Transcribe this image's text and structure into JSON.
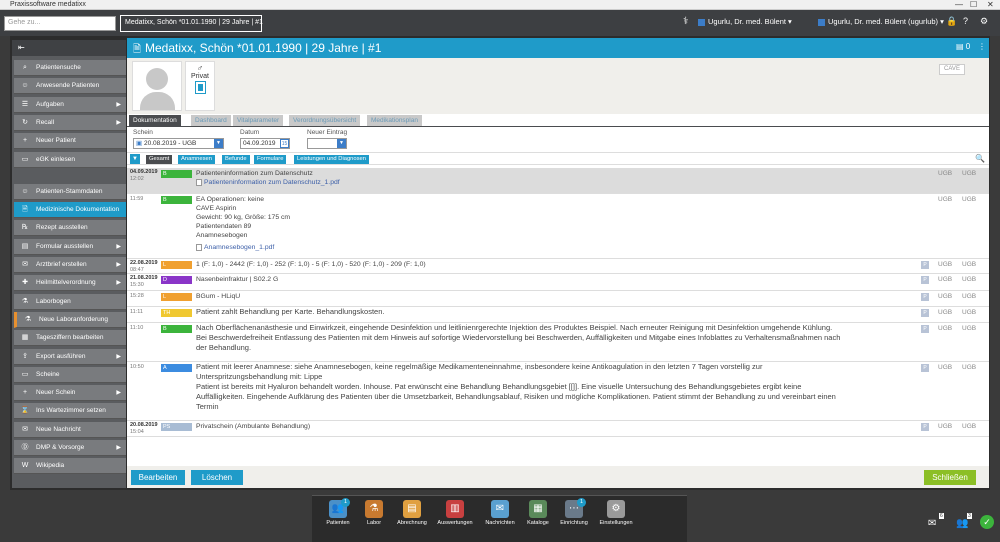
{
  "window_title": "Praxissoftware medatixx",
  "topbar": {
    "search_placeholder": "Gehe zu...",
    "patient_context": "Medatixx, Schön *01.01.1990 | 29 Jahre | #1",
    "user1": "Ugurlu, Dr. med. Bülent",
    "user2": "Ugurlu, Dr. med. Bülent (ugurlub)"
  },
  "header": {
    "title": "Medatixx, Schön *01.01.1990 | 29 Jahre | #1",
    "count": "0"
  },
  "patient": {
    "gender_symbol": "♂",
    "insurance": "Privat",
    "cave": "CAVE"
  },
  "sidebar": {
    "items": [
      {
        "label": "Patientensuche",
        "icon": "person-search-icon"
      },
      {
        "label": "Anwesende Patienten",
        "icon": "people-icon"
      },
      {
        "label": "Aufgaben",
        "icon": "tasks-icon"
      },
      {
        "label": "Recall",
        "icon": "recall-icon"
      },
      {
        "label": "Neuer Patient",
        "icon": "new-patient-icon"
      },
      {
        "label": "eGK einlesen",
        "icon": "card-icon"
      },
      {
        "label": "Patienten-Stammdaten",
        "icon": "person-icon"
      },
      {
        "label": "Medizinische Dokumentation",
        "icon": "doc-icon"
      },
      {
        "label": "Rezept ausstellen",
        "icon": "prescription-icon"
      },
      {
        "label": "Formular ausstellen",
        "icon": "form-icon"
      },
      {
        "label": "Arztbrief erstellen",
        "icon": "letter-icon"
      },
      {
        "label": "Heilmittelverordnung",
        "icon": "remedy-icon"
      },
      {
        "label": "Laborbogen",
        "icon": "lab-icon"
      },
      {
        "label": "Neue Laboranforderung",
        "icon": "lab-request-icon"
      },
      {
        "label": "Tagesziffern bearbeiten",
        "icon": "day-codes-icon"
      },
      {
        "label": "Export ausführen",
        "icon": "export-icon"
      },
      {
        "label": "Scheine",
        "icon": "voucher-icon"
      },
      {
        "label": "Neuer Schein",
        "icon": "new-voucher-icon"
      },
      {
        "label": "Ins Wartezimmer setzen",
        "icon": "waiting-room-icon"
      },
      {
        "label": "Neue Nachricht",
        "icon": "message-icon"
      },
      {
        "label": "DMP & Vorsorge",
        "icon": "dmp-icon"
      },
      {
        "label": "Wikipedia",
        "icon": "wikipedia-icon"
      }
    ]
  },
  "tabs": [
    "Dokumentation",
    "Dashboard",
    "Vitalparameter",
    "Verordnungsübersicht",
    "Medikationsplan"
  ],
  "filters": {
    "schein_label": "Schein",
    "schein_value": "20.08.2019 - UGB",
    "datum_label": "Datum",
    "datum_value": "04.09.2019",
    "neuer_eintrag_label": "Neuer Eintrag",
    "buttons": [
      "Gesamt",
      "Anamnesen",
      "Befunde",
      "Formulare",
      "Leistungen und Diagnosen"
    ]
  },
  "entries": [
    {
      "date": "04.09.2019",
      "time": "12:02",
      "tag": "B",
      "color": "#3cb43c",
      "lines": [
        "Patienteninformation zum Datenschutz"
      ],
      "pdf": "Patienteninformation zum Datenschutz_1.pdf",
      "ugb1": "UGB",
      "ugb2": "UGB"
    },
    {
      "date": "",
      "time": "11:59",
      "tag": "B",
      "color": "#3cb43c",
      "lines": [
        "EA Operationen: keine",
        "CAVE Aspirin",
        "Gewicht: 90 kg, Größe: 175 cm",
        "Patientendaten 89",
        "Anamnesebogen"
      ],
      "pdf": "Anamnesebogen_1.pdf",
      "ugb1": "UGB",
      "ugb2": "UGB"
    },
    {
      "date": "22.08.2019",
      "time": "08:47",
      "tag": "L",
      "color": "#f0a030",
      "lines": [
        "1 (F: 1,0) - 2442 (F: 1,0) - 252 (F: 1,0) - 5 (F: 1,0) - 520 (F: 1,0) - 209 (F: 1,0)"
      ],
      "ugb1": "UGB",
      "ugb2": "UGB",
      "p": "P"
    },
    {
      "date": "21.08.2019",
      "time": "15:30",
      "tag": "D",
      "color": "#8a35c8",
      "lines": [
        "Nasenbeinfraktur | S02.2 G"
      ],
      "ugb1": "UGB",
      "ugb2": "UGB",
      "p": "P"
    },
    {
      "date": "",
      "time": "15:28",
      "tag": "L",
      "color": "#f0a030",
      "lines": [
        "BGum - HLiqU"
      ],
      "ugb1": "UGB",
      "ugb2": "UGB",
      "p": "P"
    },
    {
      "date": "",
      "time": "11:11",
      "tag": "TH",
      "color": "#f0c830",
      "lines": [
        "Patient zahlt Behandlung per Karte. Behandlungskosten."
      ],
      "ugb1": "UGB",
      "ugb2": "UGB",
      "p": "P"
    },
    {
      "date": "",
      "time": "11:10",
      "tag": "B",
      "color": "#3cb43c",
      "lines": [
        "Nach Oberflächenanästhesie und Einwirkzeit, eingehende Desinfektion und leitlinienrgerechte Injektion des Produktes Beispiel. Nach erneuter Reinigung mit Desinfektion umgehende Kühlung.",
        "Bei Beschwerdefreiheit Entlassung des Patienten mit dem Hinweis auf sofortige Wiedervorstellung bei Beschwerden, Auffälligkeiten und Mitgabe eines Infoblattes zu Verhaltensmaßnahmen nach",
        "der Behandlung."
      ],
      "ugb1": "UGB",
      "ugb2": "UGB",
      "p": "P"
    },
    {
      "date": "",
      "time": "10:50",
      "tag": "A",
      "color": "#3c8ce0",
      "lines": [
        "Patient mit leerer Anamnese: siehe Anamnesebogen, keine regelmäßige Medikamenteneinnahme, insbesondere keine Antikoagulation in den letzten 7 Tagen vorstellig zur",
        "Unterspritzungsbehandlung mit: Lippe",
        "Patient ist bereits mit Hyaluron behandelt worden. Inhouse. Pat erwünscht eine Behandlung Behandlungsgebiet [[]]. Eine visuelle Untersuchung des Behandlungsgebietes ergibt keine",
        "Auffälligkeiten. Eingehende Aufklärung des Patienten über die Umsetzbarkeit, Behandlungsablauf, Risiken und mögliche Komplikationen. Patient stimmt der Behandlung zu und vereinbart einen",
        "Termin"
      ],
      "ugb1": "UGB",
      "ugb2": "UGB",
      "p": "P"
    },
    {
      "date": "20.08.2019",
      "time": "15:04",
      "tag": "PS",
      "color": "#a8bcd4",
      "lines": [
        "Privatschein (Ambulante Behandlung)"
      ],
      "ugb1": "UGB",
      "ugb2": "UGB",
      "p": "P"
    }
  ],
  "bottom": {
    "edit": "Bearbeiten",
    "delete": "Löschen",
    "close": "Schließen"
  },
  "taskbar": [
    {
      "label": "Patienten",
      "icon": "patients-icon",
      "badge": "1",
      "color": "#4a90c8"
    },
    {
      "label": "Labor",
      "icon": "lab-flask-icon",
      "color": "#c87a30"
    },
    {
      "label": "Abrechnung",
      "icon": "billing-icon",
      "color": "#e0a040"
    },
    {
      "label": "Auswertungen",
      "icon": "stats-icon",
      "color": "#c84040"
    },
    {
      "label": "Nachrichten",
      "icon": "messages-icon",
      "color": "#5aa0d0"
    },
    {
      "label": "Kataloge",
      "icon": "catalog-icon",
      "color": "#5a8a5a"
    },
    {
      "label": "Einrichtung",
      "icon": "setup-icon",
      "badge": "1",
      "color": "#6a7a8a"
    },
    {
      "label": "Einstellungen",
      "icon": "settings-gear-icon",
      "color": "#9a9a9a"
    }
  ],
  "dock": {
    "mail_count": "6",
    "users_count": "3"
  }
}
